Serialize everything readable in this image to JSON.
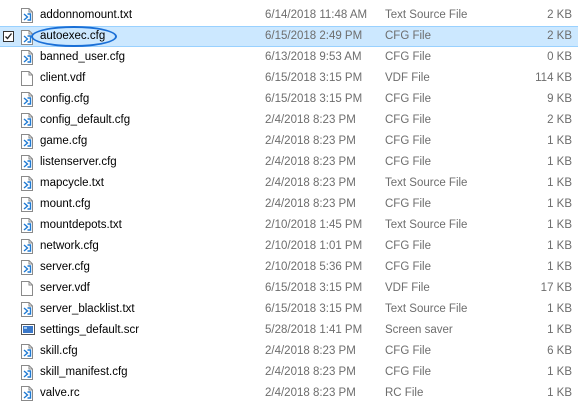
{
  "files": [
    {
      "name": "addonnomount.txt",
      "date": "6/14/2018 11:48 AM",
      "type": "Text Source File",
      "size": "2 KB",
      "icon": "vscode-file-icon",
      "selected": false
    },
    {
      "name": "autoexec.cfg",
      "date": "6/15/2018 2:49 PM",
      "type": "CFG File",
      "size": "2 KB",
      "icon": "vscode-file-icon",
      "selected": true
    },
    {
      "name": "banned_user.cfg",
      "date": "6/13/2018 9:53 AM",
      "type": "CFG File",
      "size": "0 KB",
      "icon": "vscode-file-icon",
      "selected": false
    },
    {
      "name": "client.vdf",
      "date": "6/15/2018 3:15 PM",
      "type": "VDF File",
      "size": "114 KB",
      "icon": "blank-file-icon",
      "selected": false
    },
    {
      "name": "config.cfg",
      "date": "6/15/2018 3:15 PM",
      "type": "CFG File",
      "size": "9 KB",
      "icon": "vscode-file-icon",
      "selected": false
    },
    {
      "name": "config_default.cfg",
      "date": "2/4/2018 8:23 PM",
      "type": "CFG File",
      "size": "2 KB",
      "icon": "vscode-file-icon",
      "selected": false
    },
    {
      "name": "game.cfg",
      "date": "2/4/2018 8:23 PM",
      "type": "CFG File",
      "size": "1 KB",
      "icon": "vscode-file-icon",
      "selected": false
    },
    {
      "name": "listenserver.cfg",
      "date": "2/4/2018 8:23 PM",
      "type": "CFG File",
      "size": "1 KB",
      "icon": "vscode-file-icon",
      "selected": false
    },
    {
      "name": "mapcycle.txt",
      "date": "2/4/2018 8:23 PM",
      "type": "Text Source File",
      "size": "1 KB",
      "icon": "vscode-file-icon",
      "selected": false
    },
    {
      "name": "mount.cfg",
      "date": "2/4/2018 8:23 PM",
      "type": "CFG File",
      "size": "1 KB",
      "icon": "vscode-file-icon",
      "selected": false
    },
    {
      "name": "mountdepots.txt",
      "date": "2/10/2018 1:45 PM",
      "type": "Text Source File",
      "size": "1 KB",
      "icon": "vscode-file-icon",
      "selected": false
    },
    {
      "name": "network.cfg",
      "date": "2/10/2018 1:01 PM",
      "type": "CFG File",
      "size": "1 KB",
      "icon": "vscode-file-icon",
      "selected": false
    },
    {
      "name": "server.cfg",
      "date": "2/10/2018 5:36 PM",
      "type": "CFG File",
      "size": "1 KB",
      "icon": "vscode-file-icon",
      "selected": false
    },
    {
      "name": "server.vdf",
      "date": "6/15/2018 3:15 PM",
      "type": "VDF File",
      "size": "17 KB",
      "icon": "blank-file-icon",
      "selected": false
    },
    {
      "name": "server_blacklist.txt",
      "date": "6/15/2018 3:15 PM",
      "type": "Text Source File",
      "size": "1 KB",
      "icon": "vscode-file-icon",
      "selected": false
    },
    {
      "name": "settings_default.scr",
      "date": "5/28/2018 1:41 PM",
      "type": "Screen saver",
      "size": "1 KB",
      "icon": "screensaver-file-icon",
      "selected": false
    },
    {
      "name": "skill.cfg",
      "date": "2/4/2018 8:23 PM",
      "type": "CFG File",
      "size": "6 KB",
      "icon": "vscode-file-icon",
      "selected": false
    },
    {
      "name": "skill_manifest.cfg",
      "date": "2/4/2018 8:23 PM",
      "type": "CFG File",
      "size": "1 KB",
      "icon": "vscode-file-icon",
      "selected": false
    },
    {
      "name": "valve.rc",
      "date": "2/4/2018 8:23 PM",
      "type": "RC File",
      "size": "1 KB",
      "icon": "vscode-file-icon",
      "selected": false
    }
  ],
  "colors": {
    "selection_background": "#cce8ff",
    "selection_border": "#99d1ff",
    "highlight_oval": "#1a6fd6",
    "vscode_blue": "#1f7ad3",
    "secondary_text": "#6d6d6d"
  }
}
